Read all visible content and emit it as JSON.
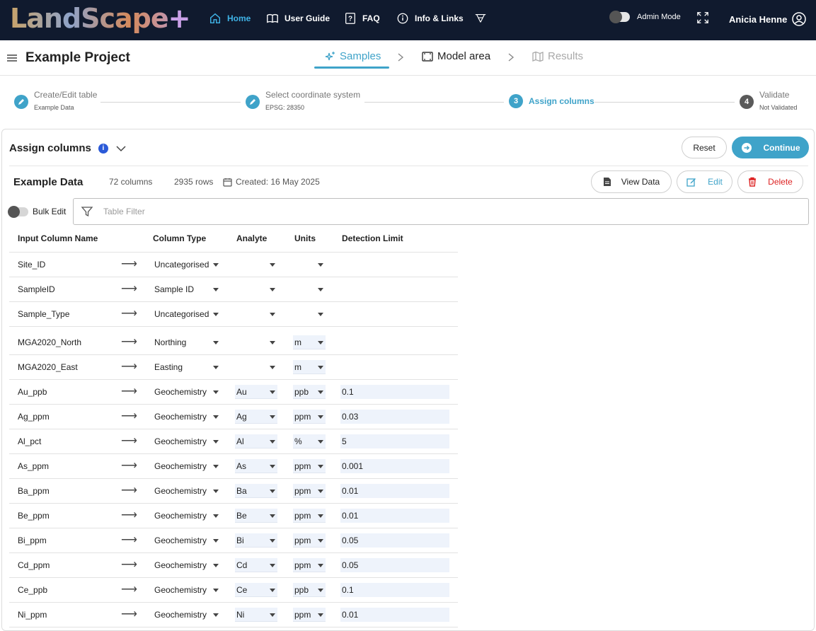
{
  "topnav": {
    "logo_text": "LandScape",
    "logo_plus": "+",
    "items": [
      {
        "label": "Home",
        "icon": "home-icon",
        "active": true
      },
      {
        "label": "User Guide",
        "icon": "book-icon"
      },
      {
        "label": "FAQ",
        "icon": "question-icon"
      },
      {
        "label": "Info & Links",
        "icon": "info-icon"
      },
      {
        "label": "",
        "icon": "xt-icon"
      }
    ],
    "admin_label": "Admin Mode",
    "user_name": "Anicia Henne"
  },
  "project": {
    "title": "Example Project",
    "tabs": [
      {
        "label": "Samples",
        "icon": "sparkle-icon",
        "state": "active"
      },
      {
        "label": "Model area",
        "icon": "map-frame-icon",
        "state": "normal"
      },
      {
        "label": "Results",
        "icon": "map-icon",
        "state": "disabled"
      }
    ]
  },
  "stepper": {
    "steps": [
      {
        "marker": "",
        "title": "Create/Edit table",
        "sub": "Example Data"
      },
      {
        "marker": "",
        "title": "Select coordinate system",
        "sub": "EPSG: 28350"
      },
      {
        "marker": "3",
        "title": "Assign columns",
        "sub": ""
      },
      {
        "marker": "4",
        "title": "Validate",
        "sub": "Not Validated"
      }
    ]
  },
  "panel": {
    "title": "Assign columns",
    "info_glyph": "i",
    "reset_label": "Reset",
    "continue_label": "Continue"
  },
  "dataset": {
    "name": "Example Data",
    "columns": "72 columns",
    "rows": "2935 rows",
    "created": "Created: 16 May 2025",
    "view_label": "View Data",
    "edit_label": "Edit",
    "delete_label": "Delete"
  },
  "bulk_edit_label": "Bulk Edit",
  "filter": {
    "placeholder": "Table Filter"
  },
  "table": {
    "headers": [
      "Input Column Name",
      "Column Type",
      "Analyte",
      "Units",
      "Detection Limit"
    ],
    "rows": [
      {
        "name": "Site_ID",
        "type": "Uncategorised",
        "analyte": "",
        "units": "",
        "dl": ""
      },
      {
        "name": "SampleID",
        "type": "Sample ID",
        "analyte": "",
        "units": "",
        "dl": ""
      },
      {
        "name": "Sample_Type",
        "type": "Uncategorised",
        "analyte": "",
        "units": "",
        "dl": ""
      },
      {
        "name": "MGA2020_North",
        "type": "Northing",
        "analyte": "",
        "units": "m",
        "dl": ""
      },
      {
        "name": "MGA2020_East",
        "type": "Easting",
        "analyte": "",
        "units": "m",
        "dl": ""
      },
      {
        "name": "Au_ppb",
        "type": "Geochemistry",
        "analyte": "Au",
        "units": "ppb",
        "dl": "0.1"
      },
      {
        "name": "Ag_ppm",
        "type": "Geochemistry",
        "analyte": "Ag",
        "units": "ppm",
        "dl": "0.03"
      },
      {
        "name": "Al_pct",
        "type": "Geochemistry",
        "analyte": "Al",
        "units": "%",
        "dl": "5"
      },
      {
        "name": "As_ppm",
        "type": "Geochemistry",
        "analyte": "As",
        "units": "ppm",
        "dl": "0.001"
      },
      {
        "name": "Ba_ppm",
        "type": "Geochemistry",
        "analyte": "Ba",
        "units": "ppm",
        "dl": "0.01"
      },
      {
        "name": "Be_ppm",
        "type": "Geochemistry",
        "analyte": "Be",
        "units": "ppm",
        "dl": "0.01"
      },
      {
        "name": "Bi_ppm",
        "type": "Geochemistry",
        "analyte": "Bi",
        "units": "ppm",
        "dl": "0.05"
      },
      {
        "name": "Cd_ppm",
        "type": "Geochemistry",
        "analyte": "Cd",
        "units": "ppm",
        "dl": "0.05"
      },
      {
        "name": "Ce_ppb",
        "type": "Geochemistry",
        "analyte": "Ce",
        "units": "ppb",
        "dl": "0.1"
      },
      {
        "name": "Ni_ppm",
        "type": "Geochemistry",
        "analyte": "Ni",
        "units": "ppm",
        "dl": "0.01"
      }
    ]
  },
  "colors": {
    "accent": "#3fa3c9",
    "nav_bg": "#101a2e",
    "danger": "#dd2222",
    "info": "#2b5ad8"
  }
}
